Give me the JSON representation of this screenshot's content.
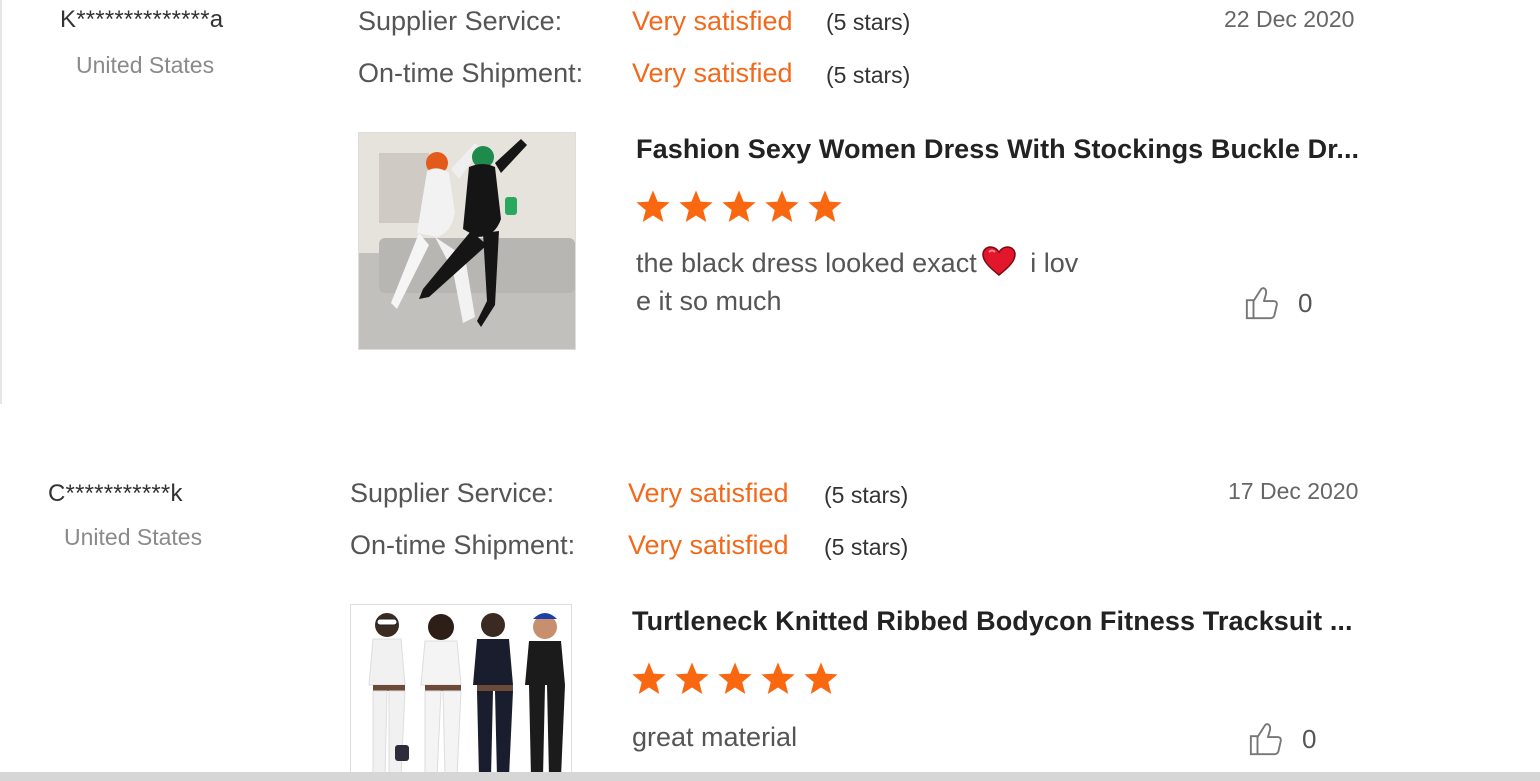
{
  "colors": {
    "accent": "#f2691b",
    "star": "#f96811",
    "heart": "#e3172b"
  },
  "reviews": [
    {
      "buyer": "K**************a",
      "country": "United States",
      "ratings": [
        {
          "label": "Supplier Service:",
          "value": "Very satisfied",
          "stars_text": "(5 stars)"
        },
        {
          "label": "On-time Shipment:",
          "value": "Very satisfied",
          "stars_text": "(5 stars)"
        }
      ],
      "date": "22 Dec 2020",
      "product_title": "Fashion Sexy Women Dress With Stockings Buckle Dr...",
      "product_rating": 5,
      "text_part1": "the black dress looked exact",
      "text_emoji": "heart-emoji",
      "text_part2": " i lov",
      "text_line2": "e it so much",
      "likes": "0"
    },
    {
      "buyer": "C***********k",
      "country": "United States",
      "ratings": [
        {
          "label": "Supplier Service:",
          "value": "Very satisfied",
          "stars_text": "(5 stars)"
        },
        {
          "label": "On-time Shipment:",
          "value": "Very satisfied",
          "stars_text": "(5 stars)"
        }
      ],
      "date": "17 Dec 2020",
      "product_title": "Turtleneck Knitted Ribbed Bodycon Fitness Tracksuit ...",
      "product_rating": 5,
      "text": "great material",
      "likes": "0"
    }
  ]
}
